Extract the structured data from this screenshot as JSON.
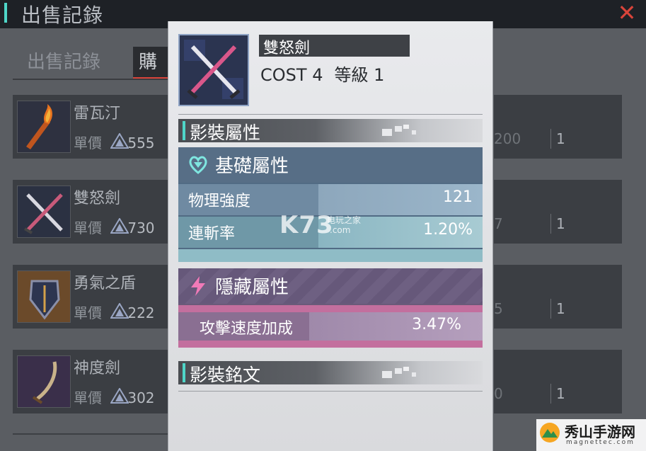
{
  "background": {
    "title": "出售記錄",
    "close_symbol": "✕",
    "tabs": [
      {
        "label": "出售記錄"
      },
      {
        "label": "購"
      }
    ],
    "rows": [
      {
        "name": "雷瓦汀",
        "price_label": "單價",
        "price": "555",
        "right_top": "",
        "right_value": "200",
        "qty": "1"
      },
      {
        "name": "雙怒劍",
        "price_label": "單價",
        "price": "730",
        "right_top": "",
        "right_value": "7",
        "qty": "1"
      },
      {
        "name": "勇氣之盾",
        "price_label": "單價",
        "price": "222",
        "right_top": "",
        "right_value": "5",
        "qty": "1"
      },
      {
        "name": "神度劍",
        "price_label": "單價",
        "price": "302",
        "right_top": "",
        "right_value": "0",
        "qty": "1"
      }
    ]
  },
  "popup": {
    "item_name": "雙怒劍",
    "cost_label": "COST",
    "cost_value": "4",
    "level_label": "等級",
    "level_value": "1",
    "attributes_title": "影裝屬性",
    "basic": {
      "title": "基礎屬性",
      "stats": [
        {
          "name": "物理強度",
          "value": "121"
        },
        {
          "name": "連斬率",
          "value": "1.20%"
        }
      ]
    },
    "hidden": {
      "title": "隱藏屬性",
      "stats": [
        {
          "name": "攻擊速度加成",
          "value": "3.47%"
        }
      ]
    },
    "inscription_title": "影裝銘文"
  },
  "watermarks": {
    "k73": "K73",
    "k73_sub1": "电玩之家",
    "k73_sub2": ".com",
    "corner_title": "秀山手游网",
    "corner_url": "magnettec.com"
  },
  "colors": {
    "accent": "#4fd6c8",
    "close": "#d9443a",
    "basic_panel": "#516b84",
    "hidden_panel": "#6a5a79",
    "hidden_strip": "#c36f9e"
  },
  "icons": {
    "close": "close-icon",
    "currency": "triangle-crystal-icon",
    "basic": "heart-shield-icon",
    "hidden": "lightning-icon"
  }
}
